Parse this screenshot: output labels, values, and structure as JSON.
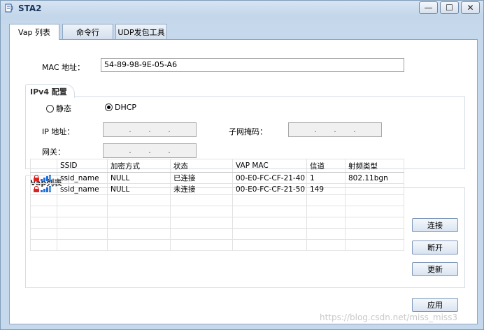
{
  "window": {
    "title": "STA2",
    "min": "—",
    "max": "☐",
    "close": "✕"
  },
  "tabs": [
    "Vap 列表",
    "命令行",
    "UDP发包工具"
  ],
  "mac": {
    "label": "MAC 地址：",
    "value": "54-89-98-9E-05-A6"
  },
  "ipv4": {
    "title": "IPv4 配置",
    "static_label": "静态",
    "dhcp_label": "DHCP",
    "selected": "DHCP",
    "ip_label": "IP 地址：",
    "mask_label": "子网掩码：",
    "gateway_label": "网关：",
    "ip_dots": ".  .  .",
    "dot": "."
  },
  "vap": {
    "title": "Vap列表",
    "columns": [
      "",
      "SSID",
      "加密方式",
      "状态",
      "VAP MAC",
      "信道",
      "射频类型"
    ],
    "rows": [
      {
        "ssid": "ssid_name",
        "enc": "NULL",
        "status": "已连接",
        "mac": "00-E0-FC-CF-21-40",
        "channel": "1",
        "radio": "802.11bgn",
        "locked": true,
        "signal": 3
      },
      {
        "ssid": "ssid_name",
        "enc": "NULL",
        "status": "未连接",
        "mac": "00-E0-FC-CF-21-50",
        "channel": "149",
        "radio": "",
        "locked": true,
        "signal": 3
      }
    ]
  },
  "buttons": {
    "connect": "连接",
    "disconnect": "断开",
    "refresh": "更新",
    "apply": "应用"
  },
  "watermark": "https://blog.csdn.net/miss_miss3"
}
